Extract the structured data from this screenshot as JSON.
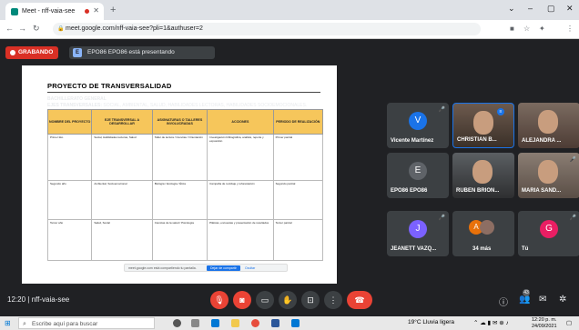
{
  "browser": {
    "tab_title": "Meet - nff-vaia-see",
    "new_tab": "+",
    "url": "meet.google.com/nff-vaia-see?pli=1&authuser=2",
    "win_controls": [
      "⌄",
      "–",
      "▢",
      "✕"
    ]
  },
  "meet": {
    "recording_label": "GRABANDO",
    "presenter_initial": "E",
    "presenting_label": "EPO86 EPO86 está presentando",
    "meeting_time": "12:20",
    "meeting_code": "nff-vaia-see",
    "participant_count": "43"
  },
  "document": {
    "title": "PROYECTO DE TRANSVERSALIDAD",
    "subtitle": "BACHILLERATO GENERAL",
    "ejes_label": "EJES TRANSVERSALES:",
    "ejes_value": "SOCIAL, AMBIENTAL, SALUD, HABILIDADES LECTORAS, HABILIDADES SOCIOEMOCIONALES.",
    "headers": [
      "NOMBRE DEL PROYECTO",
      "EJE TRANSVERSAL A DESARROLLAR",
      "ASIGNATURAS O TALLERES INVOLUCRADAS",
      "ACCIONES",
      "PERIODO DE REALIZACIÓN"
    ],
    "rows": [
      [
        "Primer tiko",
        "Social, Habilidades lectoras, Salud",
        "Taller de lectura / Ciencias / Orientación",
        "Investigación bibliográfica, análisis, reporte y exposición",
        "Primer parcial"
      ],
      [
        "Segundo año",
        "Ambiental, Socioemocional",
        "Biología / Ecología / Ética",
        "Campaña de reciclaje y reforestación",
        "Segundo parcial"
      ],
      [
        "Tercer año",
        "Salud, Social",
        "Ciencias de la salud / Psicología",
        "Pláticas, encuestas y presentación de resultados",
        "Tercer parcial"
      ]
    ],
    "share_notice": "meet.google.com está compartiendo tu pantalla.",
    "stop_button": "Dejar de compartir",
    "hide_button": "Ocultar"
  },
  "participants": [
    {
      "name": "Vicente Martínez",
      "initial": "V",
      "color": "#1a73e8",
      "video": false
    },
    {
      "name": "CHRISTIAN B...",
      "initial": "",
      "color": "",
      "video": true
    },
    {
      "name": "ALEJANDRA ...",
      "initial": "",
      "color": "",
      "video": true
    },
    {
      "name": "EPO86 EPO86",
      "initial": "E",
      "color": "#5f6368",
      "video": false
    },
    {
      "name": "RUBEN BRION...",
      "initial": "",
      "color": "",
      "video": true
    },
    {
      "name": "MARIA SAND...",
      "initial": "",
      "color": "",
      "video": true
    },
    {
      "name": "JEANETT VAZQ...",
      "initial": "J",
      "color": "#7b61ff",
      "video": false
    },
    {
      "name": "34 más",
      "initial": "A",
      "color": "#e8710a",
      "video": false
    },
    {
      "name": "Tú",
      "initial": "G",
      "color": "#e91e63",
      "video": false
    }
  ],
  "taskbar": {
    "search_placeholder": "Escribe aquí para buscar",
    "weather": "19°C  Lluvia ligera",
    "time": "12:20 p. m.",
    "date": "24/09/2021"
  }
}
